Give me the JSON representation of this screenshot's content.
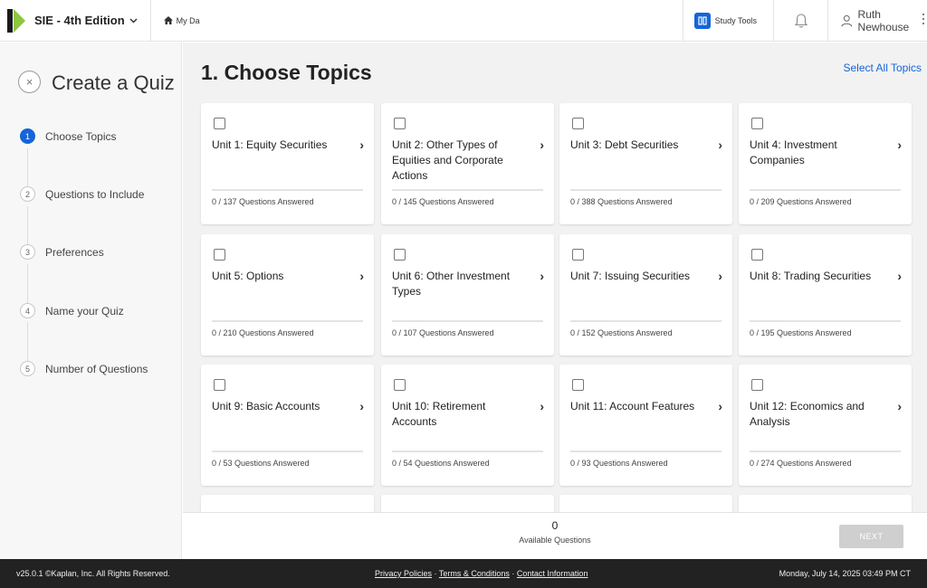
{
  "header": {
    "course_title": "SIE - 4th Edition",
    "course_caret": "⌄",
    "breadcrumb": "My Da",
    "study_tools_label": "Study Tools",
    "user_name": "Ruth Newhouse"
  },
  "sidebar": {
    "close_glyph": "×",
    "title": "Create a Quiz",
    "steps": [
      {
        "number": "1",
        "label": "Choose Topics",
        "active": true
      },
      {
        "number": "2",
        "label": "Questions to Include",
        "active": false
      },
      {
        "number": "3",
        "label": "Preferences",
        "active": false
      },
      {
        "number": "4",
        "label": "Name your Quiz",
        "active": false
      },
      {
        "number": "5",
        "label": "Number of Questions",
        "active": false
      }
    ]
  },
  "main": {
    "title": "1. Choose Topics",
    "select_all_label": "Select All Topics",
    "topics": [
      {
        "title": "Unit 1: Equity Securities",
        "answered": "0 / 137 Questions Answered",
        "progress": 0
      },
      {
        "title": "Unit 2: Other Types of Equities and Corporate Actions",
        "answered": "0 / 145 Questions Answered",
        "progress": 0
      },
      {
        "title": "Unit 3: Debt Securities",
        "answered": "0 / 388 Questions Answered",
        "progress": 0
      },
      {
        "title": "Unit 4: Investment Companies",
        "answered": "0 / 209 Questions Answered",
        "progress": 0
      },
      {
        "title": "Unit 5: Options",
        "answered": "0 / 210 Questions Answered",
        "progress": 0
      },
      {
        "title": "Unit 6: Other Investment Types",
        "answered": "0 / 107 Questions Answered",
        "progress": 0
      },
      {
        "title": "Unit 7: Issuing Securities",
        "answered": "0 / 152 Questions Answered",
        "progress": 0
      },
      {
        "title": "Unit 8: Trading Securities",
        "answered": "0 / 195 Questions Answered",
        "progress": 0
      },
      {
        "title": "Unit 9: Basic Accounts",
        "answered": "0 / 53 Questions Answered",
        "progress": 0
      },
      {
        "title": "Unit 10: Retirement Accounts",
        "answered": "0 / 54 Questions Answered",
        "progress": 0
      },
      {
        "title": "Unit 11: Account Features",
        "answered": "0 / 93 Questions Answered",
        "progress": 0
      },
      {
        "title": "Unit 12: Economics and Analysis",
        "answered": "0 / 274 Questions Answered",
        "progress": 0
      }
    ],
    "arrow_glyph": "›"
  },
  "bottom": {
    "available_count": "0",
    "available_label": "Available Questions",
    "next_label": "NEXT"
  },
  "footer": {
    "version": "v25.0.1 ©Kaplan, Inc. All Rights Reserved.",
    "privacy": "Privacy Policies",
    "terms": "Terms & Conditions",
    "contact": "Contact Information",
    "link_separator": " · ",
    "datetime": "Monday, July 14, 2025 03:49 PM CT"
  },
  "colors": {
    "accent": "#1565d8",
    "brand_green": "#8dc63f",
    "footer_bg": "#222222",
    "next_disabled": "#cfcfcf"
  },
  "icons": [
    "kaplan-logo-icon",
    "home-icon",
    "study-tools-icon",
    "bell-icon",
    "user-icon",
    "more-vertical-icon",
    "close-icon",
    "chevron-right-icon",
    "checkbox-icon"
  ]
}
